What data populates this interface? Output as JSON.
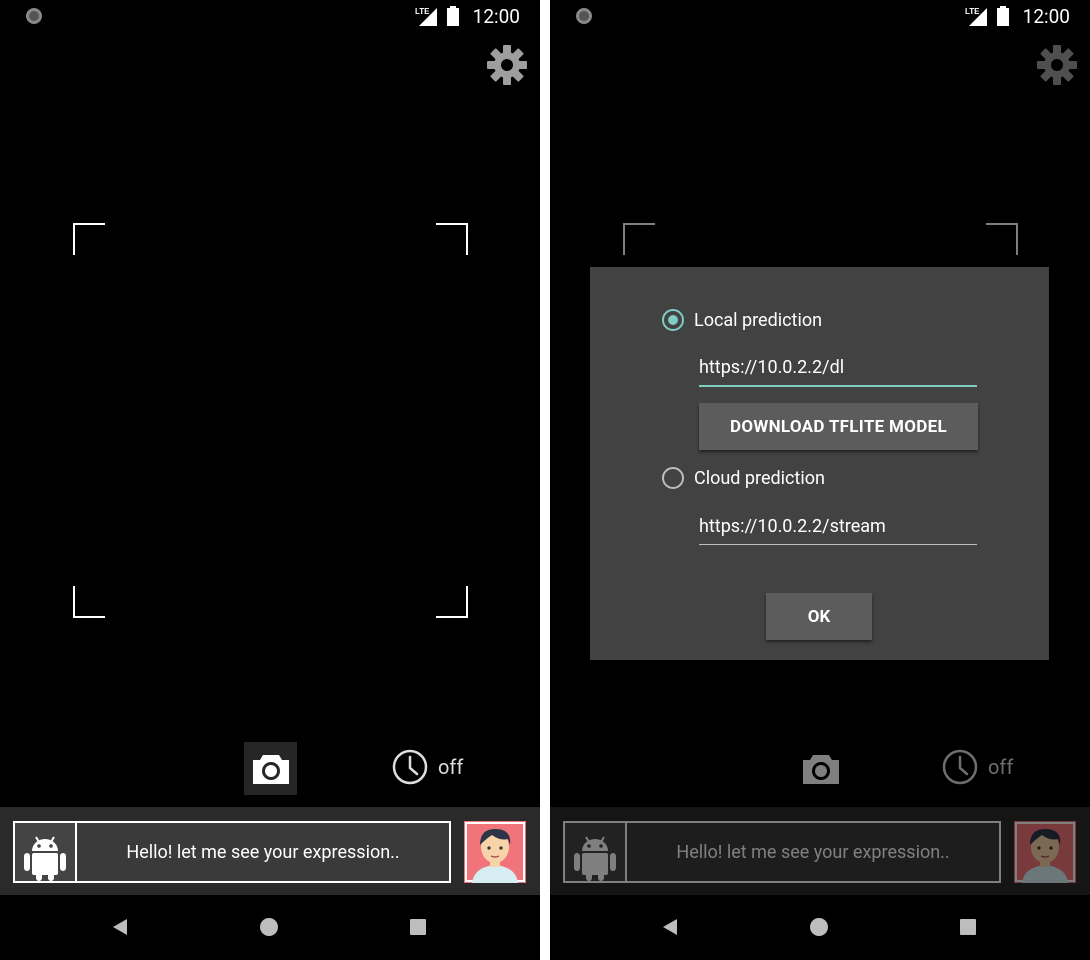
{
  "status": {
    "network": "LTE",
    "time": "12:00"
  },
  "timer": {
    "label": "off"
  },
  "message": {
    "text": "Hello! let me see your expression.."
  },
  "dialog": {
    "local_label": "Local prediction",
    "local_url": "https://10.0.2.2/dl",
    "download_button": "DOWNLOAD TFLITE MODEL",
    "cloud_label": "Cloud prediction",
    "cloud_url": "https://10.0.2.2/stream",
    "ok_button": "OK",
    "selected": "local"
  },
  "colors": {
    "accent": "#80cbc4",
    "dialog_bg": "#424242",
    "button_bg": "#5c5c5c",
    "avatar_bg": "#f0747a"
  },
  "icons": [
    "settings-gear-icon",
    "camera-icon",
    "timer-icon",
    "android-icon",
    "avatar-icon",
    "back-icon",
    "home-icon",
    "recents-icon"
  ]
}
